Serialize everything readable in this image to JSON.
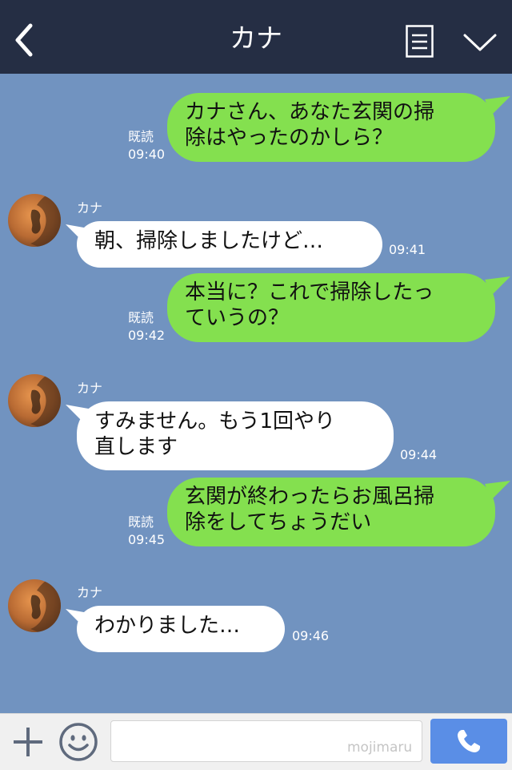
{
  "header": {
    "title": "カナ",
    "icons": [
      "back-arrow-icon",
      "menu-list-icon",
      "chevron-down-icon"
    ]
  },
  "colors": {
    "header_bg": "#252e44",
    "chat_bg": "#7193c0",
    "outgoing_bubble": "#84e04f",
    "incoming_bubble": "#ffffff",
    "send_button": "#5a8ee6"
  },
  "messages": [
    {
      "direction": "out",
      "lines": [
        "カナさん、あなた玄関の掃",
        "除はやったのかしら？"
      ],
      "read": "既読",
      "time": "09:40"
    },
    {
      "direction": "in",
      "sender": "カナ",
      "lines": [
        "朝、掃除しましたけど…"
      ],
      "time": "09:41"
    },
    {
      "direction": "out",
      "lines": [
        "本当に？これで掃除したっ",
        "ていうの？"
      ],
      "read": "既読",
      "time": "09:42"
    },
    {
      "direction": "in",
      "sender": "カナ",
      "lines": [
        "すみません。もう1回やり",
        "直します"
      ],
      "time": "09:44"
    },
    {
      "direction": "out",
      "lines": [
        "玄関が終わったらお風呂掃",
        "除をしてちょうだい"
      ],
      "read": "既読",
      "time": "09:45"
    },
    {
      "direction": "in",
      "sender": "カナ",
      "lines": [
        "わかりました…"
      ],
      "time": "09:46"
    }
  ],
  "footer": {
    "input_value": "",
    "watermark": "mojimaru",
    "icons": [
      "plus-icon",
      "smiley-icon",
      "phone-icon"
    ]
  }
}
